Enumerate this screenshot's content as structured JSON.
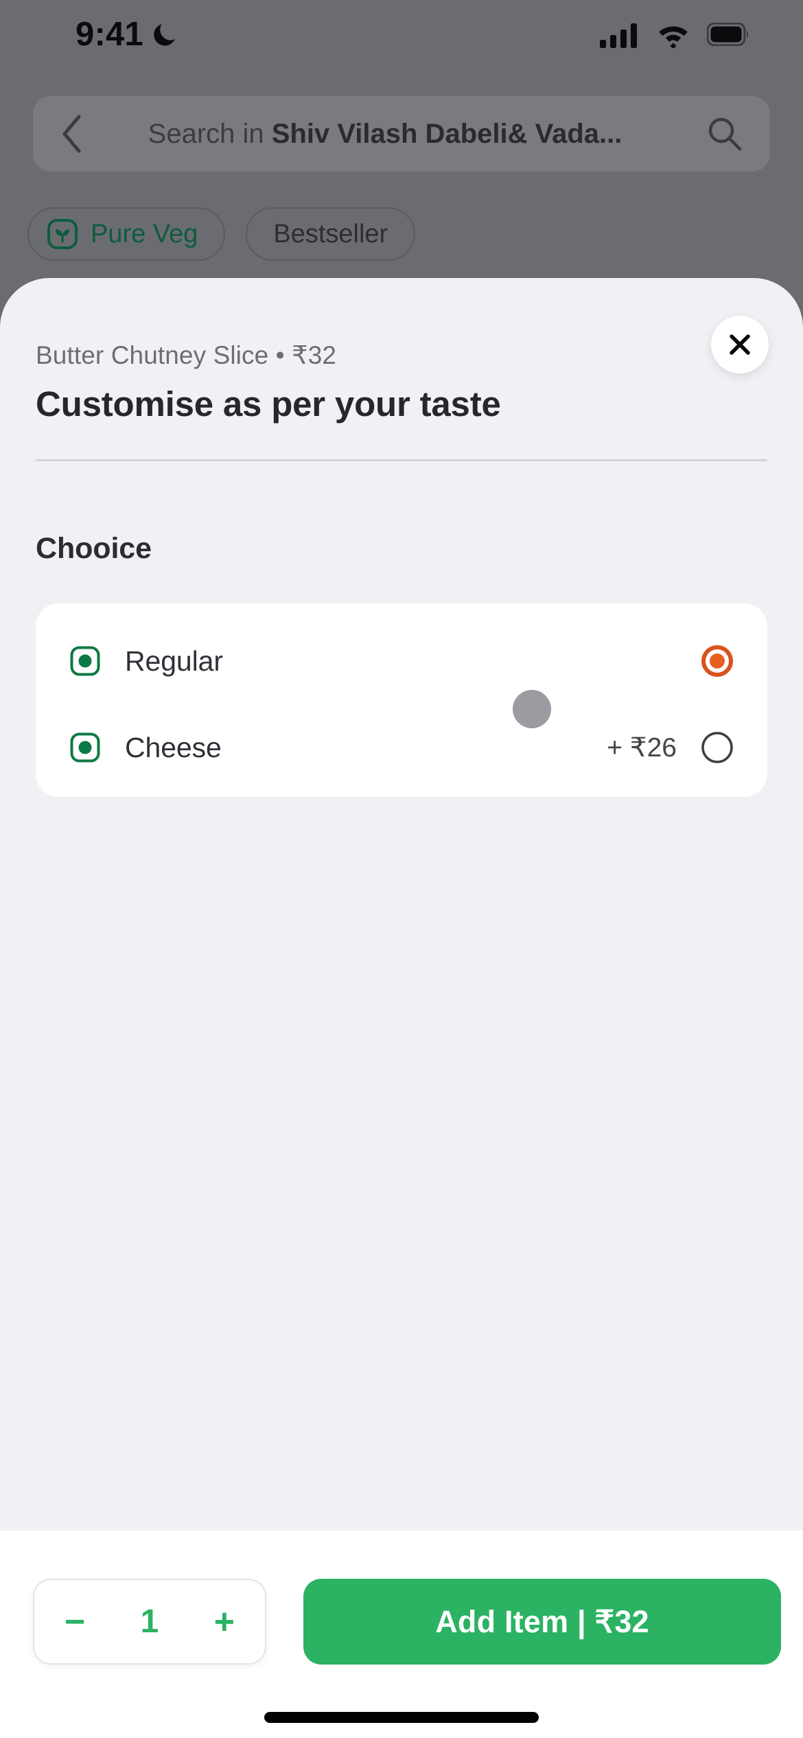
{
  "status_bar": {
    "time": "9:41",
    "moon_icon": "moon-icon",
    "cellular_icon": "cellular-signal-icon",
    "wifi_icon": "wifi-icon",
    "battery_icon": "battery-full-icon"
  },
  "search": {
    "back_icon": "chevron-left-icon",
    "prefix": "Search in ",
    "restaurant": "Shiv Vilash Dabeli& Vada...",
    "search_icon": "magnifier-icon"
  },
  "filters": [
    {
      "label": "Pure Veg",
      "icon": "pure-veg-leaf-icon",
      "active": true,
      "color": "#0d5c3c"
    },
    {
      "label": "Bestseller",
      "icon": "",
      "active": false,
      "color": "#2d2e33"
    }
  ],
  "sheet": {
    "item_summary": "Butter Chutney Slice • ₹32",
    "title": "Customise as per your taste",
    "close_icon": "close-x-icon",
    "group": {
      "title": "Chooice",
      "options": [
        {
          "label": "Regular",
          "price": "",
          "veg_icon": "veg-marker-icon",
          "selected": true,
          "radio_icon": "radio-selected-icon"
        },
        {
          "label": "Cheese",
          "price": "+ ₹26",
          "veg_icon": "veg-marker-icon",
          "selected": false,
          "radio_icon": "radio-unselected-icon"
        }
      ]
    }
  },
  "bottom_bar": {
    "decrease_label": "−",
    "quantity": "1",
    "increase_label": "+",
    "add_label": "Add Item | ₹32"
  },
  "cursor": {
    "name": "pointer-dot"
  },
  "colors": {
    "accent_green": "#2bb263",
    "veg_green": "#0d7a45",
    "selected_orange": "#d9531e",
    "sheet_bg": "#f1f1f5",
    "scrim": "#6b6c72"
  }
}
